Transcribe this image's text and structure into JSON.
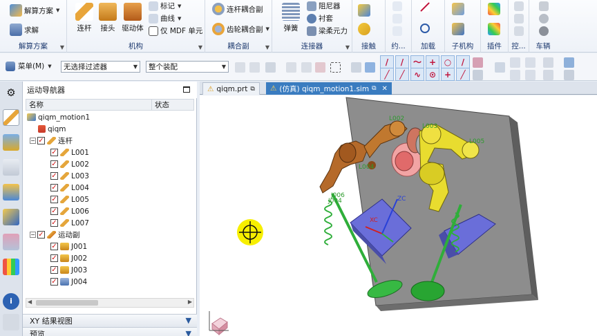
{
  "ribbon": {
    "groups": [
      {
        "label": "解算方案"
      },
      {
        "label": "机构"
      },
      {
        "label": "耦合副"
      },
      {
        "label": "连接器"
      },
      {
        "label": "接触"
      },
      {
        "label": "约..."
      },
      {
        "label": "加载"
      },
      {
        "label": "子机构"
      },
      {
        "label": "插件"
      },
      {
        "label": "控..."
      },
      {
        "label": "车辆"
      }
    ],
    "solution": {
      "new_solution": "解算方案",
      "solve": "求解"
    },
    "mechanism": {
      "link": "连杆",
      "joint": "接头",
      "driver": "驱动体",
      "marker": "标记",
      "curve": "曲线",
      "mdf_only": "仅 MDF 单元"
    },
    "coupler": {
      "link_coupler": "连杆耦合副",
      "gear_coupler": "齿轮耦合副"
    },
    "connector": {
      "spring": "弹簧",
      "damper": "阻尼器",
      "bushing": "衬套",
      "beam_force": "梁柔元力"
    }
  },
  "toolbar": {
    "menu_label": "菜单(M)",
    "filter_value": "无选择过滤器",
    "assembly_value": "整个装配"
  },
  "navigator": {
    "title": "运动导航器",
    "columns": {
      "name": "名称",
      "status": "状态"
    },
    "root": "qiqm_motion1",
    "model": "qiqm",
    "links_group": "连杆",
    "links": [
      "L001",
      "L002",
      "L003",
      "L004",
      "L005",
      "L006",
      "L007"
    ],
    "joints_group": "运动副",
    "joints": [
      "J001",
      "J002",
      "J003",
      "J004"
    ]
  },
  "panels": {
    "xy_results": "XY 结果视图",
    "preview": "预览"
  },
  "tabs": [
    {
      "label": "qiqm.prt"
    },
    {
      "label": "(仿真) qiqm_motion1.sim"
    }
  ],
  "viewport": {
    "labels": [
      "L002",
      "L003",
      "L005",
      "L004",
      "J006",
      "J004",
      "XC",
      "ZC"
    ]
  },
  "colors": {
    "accent": "#3a7cc0",
    "link_brown": "#b56a2a",
    "link_yellow": "#e9dd2e",
    "spring_green": "#2fae3a",
    "wall": "#8a8a8a",
    "block": "#6d6ed6"
  }
}
